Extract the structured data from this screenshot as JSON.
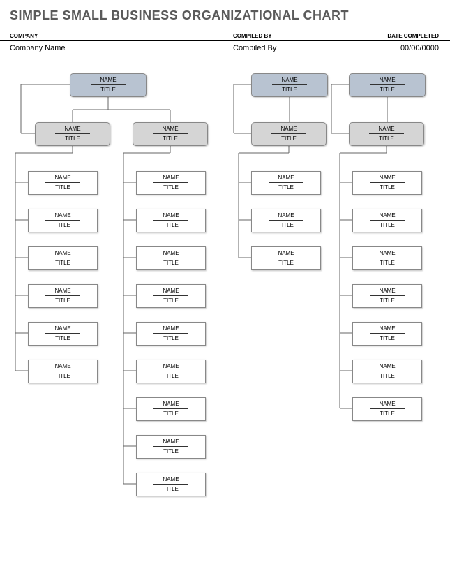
{
  "page_title": "SIMPLE SMALL BUSINESS ORGANIZATIONAL CHART",
  "header": {
    "company_label": "COMPANY",
    "compiled_label": "COMPILED BY",
    "date_label": "DATE COMPLETED",
    "company_value": "Company Name",
    "compiled_value": "Compiled By",
    "date_value": "00/00/0000"
  },
  "labels": {
    "name": "NAME",
    "title": "TITLE"
  },
  "chart_data": {
    "type": "org-chart",
    "branches": [
      {
        "top": {
          "name": "NAME",
          "title": "TITLE"
        },
        "mids": [
          {
            "name": "NAME",
            "title": "TITLE",
            "leaves": [
              {
                "name": "NAME",
                "title": "TITLE"
              },
              {
                "name": "NAME",
                "title": "TITLE"
              },
              {
                "name": "NAME",
                "title": "TITLE"
              },
              {
                "name": "NAME",
                "title": "TITLE"
              },
              {
                "name": "NAME",
                "title": "TITLE"
              },
              {
                "name": "NAME",
                "title": "TITLE"
              }
            ]
          },
          {
            "name": "NAME",
            "title": "TITLE",
            "leaves": [
              {
                "name": "NAME",
                "title": "TITLE"
              },
              {
                "name": "NAME",
                "title": "TITLE"
              },
              {
                "name": "NAME",
                "title": "TITLE"
              },
              {
                "name": "NAME",
                "title": "TITLE"
              },
              {
                "name": "NAME",
                "title": "TITLE"
              },
              {
                "name": "NAME",
                "title": "TITLE"
              },
              {
                "name": "NAME",
                "title": "TITLE"
              },
              {
                "name": "NAME",
                "title": "TITLE"
              },
              {
                "name": "NAME",
                "title": "TITLE"
              }
            ]
          }
        ]
      },
      {
        "top": {
          "name": "NAME",
          "title": "TITLE"
        },
        "mids": [
          {
            "name": "NAME",
            "title": "TITLE",
            "leaves": [
              {
                "name": "NAME",
                "title": "TITLE"
              },
              {
                "name": "NAME",
                "title": "TITLE"
              },
              {
                "name": "NAME",
                "title": "TITLE"
              }
            ]
          }
        ]
      },
      {
        "top": {
          "name": "NAME",
          "title": "TITLE"
        },
        "mids": [
          {
            "name": "NAME",
            "title": "TITLE",
            "leaves": [
              {
                "name": "NAME",
                "title": "TITLE"
              },
              {
                "name": "NAME",
                "title": "TITLE"
              },
              {
                "name": "NAME",
                "title": "TITLE"
              },
              {
                "name": "NAME",
                "title": "TITLE"
              },
              {
                "name": "NAME",
                "title": "TITLE"
              },
              {
                "name": "NAME",
                "title": "TITLE"
              },
              {
                "name": "NAME",
                "title": "TITLE"
              }
            ]
          }
        ]
      }
    ]
  }
}
